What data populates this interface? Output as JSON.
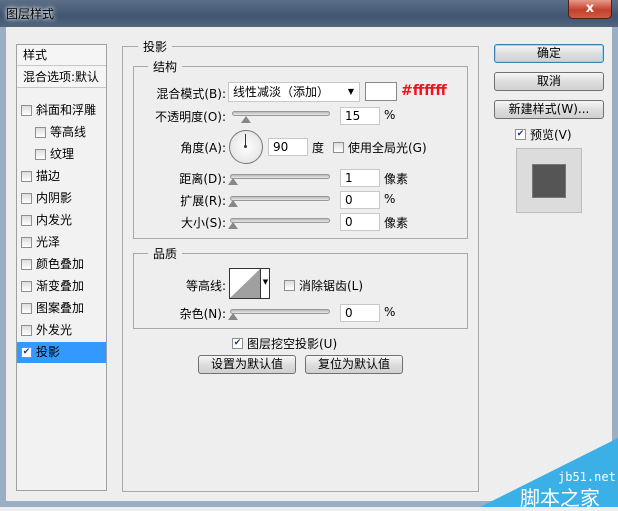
{
  "window": {
    "title": "图层样式",
    "close_label": "x"
  },
  "sidebar": {
    "header": "样式",
    "blend_options": "混合选项:默认",
    "items": [
      {
        "label": "斜面和浮雕",
        "checked": false
      },
      {
        "label": "等高线",
        "checked": false
      },
      {
        "label": "纹理",
        "checked": false
      },
      {
        "label": "描边",
        "checked": false
      },
      {
        "label": "内阴影",
        "checked": false
      },
      {
        "label": "内发光",
        "checked": false
      },
      {
        "label": "光泽",
        "checked": false
      },
      {
        "label": "颜色叠加",
        "checked": false
      },
      {
        "label": "渐变叠加",
        "checked": false
      },
      {
        "label": "图案叠加",
        "checked": false
      },
      {
        "label": "外发光",
        "checked": false
      },
      {
        "label": "投影",
        "checked": true
      }
    ]
  },
  "main": {
    "section_title": "投影",
    "structure": {
      "title": "结构",
      "blend_mode_label": "混合模式(B):",
      "blend_mode_value": "线性减淡（添加）",
      "color_hex_annotation": "#ffffff",
      "color": "#ffffff",
      "opacity_label": "不透明度(O):",
      "opacity_value": "15",
      "opacity_unit": "%",
      "angle_label": "角度(A):",
      "angle_value": "90",
      "angle_unit": "度",
      "global_light_label": "使用全局光(G)",
      "global_light_checked": false,
      "distance_label": "距离(D):",
      "distance_value": "1",
      "distance_unit": "像素",
      "spread_label": "扩展(R):",
      "spread_value": "0",
      "spread_unit": "%",
      "size_label": "大小(S):",
      "size_value": "0",
      "size_unit": "像素"
    },
    "quality": {
      "title": "品质",
      "contour_label": "等高线:",
      "antialias_label": "消除锯齿(L)",
      "antialias_checked": false,
      "noise_label": "杂色(N):",
      "noise_value": "0",
      "noise_unit": "%"
    },
    "knockout_label": "图层挖空投影(U)",
    "knockout_checked": true,
    "make_default": "设置为默认值",
    "reset_default": "复位为默认值"
  },
  "right": {
    "ok": "确定",
    "cancel": "取消",
    "new_style": "新建样式(W)...",
    "preview_label": "预览(V)",
    "preview_checked": true
  },
  "watermark": {
    "site": "jb51.net",
    "name": "脚本之家"
  }
}
